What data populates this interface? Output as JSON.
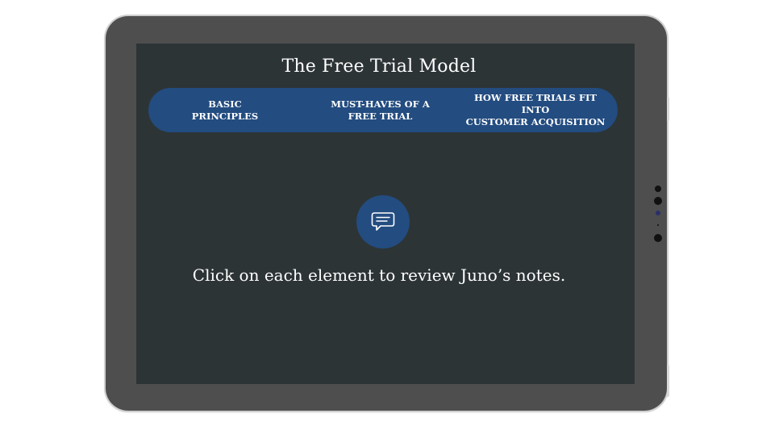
{
  "page": {
    "title": "The Free Trial Model",
    "instruction": "Click on each element to review Juno’s notes."
  },
  "nav": {
    "items": [
      {
        "label": "BASIC\nPRINCIPLES"
      },
      {
        "label": "MUST-HAVES OF A\nFREE TRIAL"
      },
      {
        "label": "HOW FREE TRIALS FIT INTO\nCUSTOMER ACQUISITION"
      }
    ]
  },
  "icons": {
    "center": "chat-bubble-icon"
  },
  "colors": {
    "screen": "#2d3436",
    "accent": "#234c80",
    "bezel": "#4e4e4e",
    "text": "#ffffff"
  }
}
